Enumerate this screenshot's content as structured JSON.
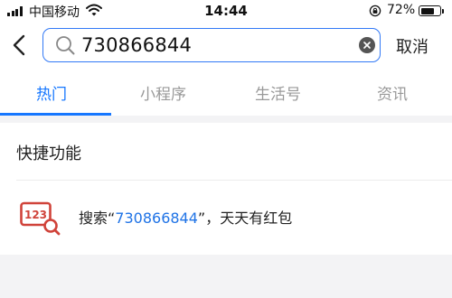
{
  "status_bar": {
    "carrier": "中国移动",
    "time": "14:44",
    "battery_percent": "72%",
    "battery_level": 0.72,
    "icons": [
      "signal-icon",
      "wifi-icon",
      "rotation-lock-icon",
      "battery-icon"
    ]
  },
  "header": {
    "search_value": "730866844",
    "cancel_label": "取消",
    "accent_color": "#3279f6",
    "icons": [
      "back-arrow-icon",
      "search-icon",
      "clear-icon"
    ]
  },
  "tabs": [
    {
      "label": "热门",
      "active": true
    },
    {
      "label": "小程序",
      "active": false
    },
    {
      "label": "生活号",
      "active": false
    },
    {
      "label": "资讯",
      "active": false
    }
  ],
  "quick_section": {
    "title": "快捷功能",
    "items": [
      {
        "icon": "number-search-icon",
        "icon_text": "123",
        "prefix": "搜索“",
        "keyword": "730866844",
        "suffix": "”，天天有红包"
      }
    ]
  }
}
